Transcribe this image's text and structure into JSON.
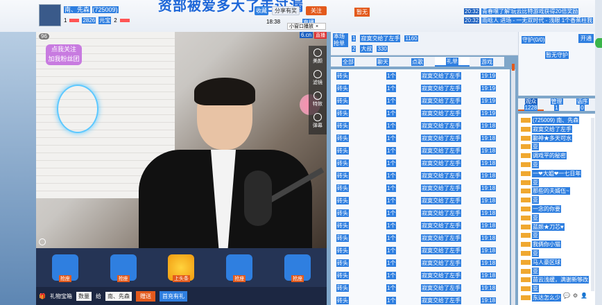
{
  "header": {
    "streamer_name": "南、先森",
    "room_id": "(725009)",
    "stat_1": "1",
    "stat_count": "2826",
    "stat_label": "元宝",
    "stat_2": "2",
    "marquee": "资部被爱多大了走过漏",
    "fav_label": "收藏",
    "share_label": "分享有奖",
    "follow_label": "关注",
    "time_small": "18:38",
    "small_label": "直播",
    "popup_label": "小窗口播放",
    "tag": "暂无"
  },
  "system_messages": [
    {
      "time": "20:32",
      "text": "青春嘿了解'玩云比特游戏获得20倍奖励"
    },
    {
      "time": "20:32",
      "text": "雨晗人 进场 - 一无双时代 - 浅眼 1个香蕉柱我"
    }
  ],
  "video": {
    "viewer_count": "96",
    "logo": "6.cn",
    "logo_tag": "直播",
    "sticker_line1": "点我关注",
    "sticker_line2": "加我粉丝团",
    "side_buttons": [
      {
        "icon": "power-icon",
        "label": "美颜"
      },
      {
        "icon": "mask-icon",
        "label": "滤镜"
      },
      {
        "icon": "effects-icon",
        "label": "特效"
      },
      {
        "icon": "toggle-icon",
        "label": "弹幕"
      }
    ]
  },
  "gifts": [
    {
      "label": "抢座"
    },
    {
      "label": "抢座"
    },
    {
      "label": "上头条"
    },
    {
      "label": "抢座"
    },
    {
      "label": "抢座"
    }
  ],
  "bottom_bar": {
    "gift_box": "礼物宝箱",
    "quantity_label": "数量",
    "recipient_prefix": "给",
    "recipient": "南、先森",
    "send_label": "赠送",
    "recharge_label": "首充有礼"
  },
  "rank": {
    "title": "本场抢单",
    "rows": [
      {
        "rank": "1",
        "name": "寂寞交给了左手",
        "value": "1160"
      },
      {
        "rank": "2",
        "name": "大叔",
        "value": "330"
      }
    ]
  },
  "tabs": {
    "items": [
      "全部",
      "聊天",
      "点歌",
      "礼单",
      "游戏"
    ],
    "active": "礼单"
  },
  "gift_list": {
    "rows": [
      {
        "gift": "砖头",
        "qty": "1个",
        "from": "寂寞交给了左手",
        "time": "19:19"
      },
      {
        "gift": "砖头",
        "qty": "1个",
        "from": "寂寞交给了左手",
        "time": "19:19"
      },
      {
        "gift": "砖头",
        "qty": "1个",
        "from": "寂寞交给了左手",
        "time": "19:19"
      },
      {
        "gift": "砖头",
        "qty": "1个",
        "from": "寂寞交给了左手",
        "time": "19:19"
      },
      {
        "gift": "砖头",
        "qty": "1个",
        "from": "寂寞交给了左手",
        "time": "19:18"
      },
      {
        "gift": "砖头",
        "qty": "1个",
        "from": "寂寞交给了左手",
        "time": "19:18"
      },
      {
        "gift": "砖头",
        "qty": "1个",
        "from": "寂寞交给了左手",
        "time": "19:18"
      },
      {
        "gift": "砖头",
        "qty": "1个",
        "from": "寂寞交给了左手",
        "time": "19:18"
      },
      {
        "gift": "砖头",
        "qty": "1个",
        "from": "寂寞交给了左手",
        "time": "19:18"
      },
      {
        "gift": "砖头",
        "qty": "1个",
        "from": "寂寞交给了左手",
        "time": "19:18"
      },
      {
        "gift": "砖头",
        "qty": "1个",
        "from": "寂寞交给了左手",
        "time": "19:18"
      },
      {
        "gift": "砖头",
        "qty": "1个",
        "from": "寂寞交给了左手",
        "time": "19:18"
      },
      {
        "gift": "砖头",
        "qty": "1个",
        "from": "寂寞交给了左手",
        "time": "19:18"
      },
      {
        "gift": "砖头",
        "qty": "1个",
        "from": "寂寞交给了左手",
        "time": "19:18"
      },
      {
        "gift": "砖头",
        "qty": "1个",
        "from": "寂寞交给了左手",
        "time": "19:18"
      },
      {
        "gift": "砖头",
        "qty": "1个",
        "from": "寂寞交给了左手",
        "time": "19:18"
      },
      {
        "gift": "砖头",
        "qty": "1个",
        "from": "寂寞交给了左手",
        "time": "19:18"
      },
      {
        "gift": "砖头",
        "qty": "1个",
        "from": "寂寞交给了左手",
        "time": "19:18"
      },
      {
        "gift": "砖头",
        "qty": "1个",
        "from": "寂寞交给了左手",
        "time": "19:18"
      }
    ]
  },
  "guard": {
    "title": "守护(0/0)",
    "open_label": "开通",
    "empty": "暂无守护"
  },
  "audience_tabs": [
    {
      "label": "观众",
      "count": "1228"
    },
    {
      "label": "管理",
      "count": "1"
    },
    {
      "label": "语序",
      "count": "0"
    }
  ],
  "audience": [
    "(725009) 南、先森",
    "寂寞交给了左手",
    "聊神★多天可水",
    "亚",
    "调戏平的秘密",
    "亚",
    "一❤大姐❤一七日年",
    "亚",
    "那些的夫婿伍~",
    "亚",
    "一念的你要",
    "亚",
    "蓝颜★刀芯♥",
    "亚",
    "我俩你小猫",
    "亚",
    "马人豪区球",
    "亚",
    "苗云浅缓，满谢新够改",
    "亚",
    "东达怎么少"
  ]
}
